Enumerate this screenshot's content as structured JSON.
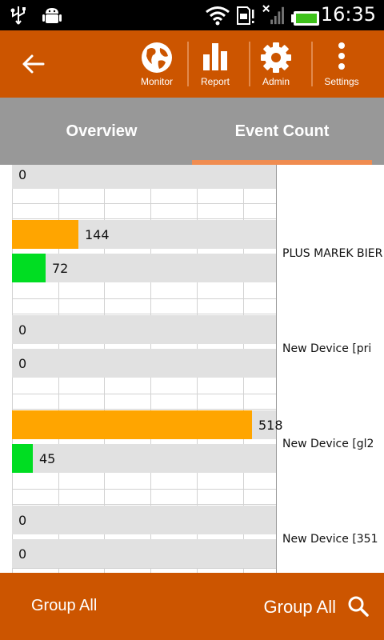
{
  "status_bar": {
    "time": "16:35",
    "icons": [
      "usb-icon",
      "android-debug-icon",
      "wifi-icon",
      "sd-card-warning-icon",
      "no-signal-icon",
      "battery-icon"
    ]
  },
  "action_bar": {
    "actions": [
      {
        "label": "Monitor",
        "icon": "globe-icon"
      },
      {
        "label": "Report",
        "icon": "bar-chart-icon"
      },
      {
        "label": "Admin",
        "icon": "gear-icon"
      },
      {
        "label": "Settings",
        "icon": "more-vert-icon"
      }
    ]
  },
  "tabs": [
    {
      "label": "Overview",
      "selected": false
    },
    {
      "label": "Event Count",
      "selected": true
    }
  ],
  "colors": {
    "primary": "#cc5500",
    "tab_bg": "#989898",
    "tab_indicator": "#f08c50",
    "series_orange": "#ffa500",
    "series_green": "#00dd22",
    "bar_bg": "#e1e1e1"
  },
  "chart_data": {
    "type": "bar",
    "orientation": "horizontal",
    "max_value": 518,
    "bars": [
      {
        "value": 0,
        "label": "0",
        "series": "green"
      },
      {
        "value": 144,
        "label": "144",
        "series": "orange"
      },
      {
        "value": 72,
        "label": "72",
        "series": "green"
      },
      {
        "value": 0,
        "label": "0",
        "series": "orange"
      },
      {
        "value": 0,
        "label": "0",
        "series": "green"
      },
      {
        "value": 518,
        "label": "518",
        "series": "orange"
      },
      {
        "value": 45,
        "label": "45",
        "series": "green"
      },
      {
        "value": 0,
        "label": "0",
        "series": "orange"
      },
      {
        "value": 0,
        "label": "0",
        "series": "green"
      }
    ],
    "device_labels": [
      "PLUS MAREK BIER",
      "New Device [pri",
      "New Device [gl2",
      "New Device [351"
    ]
  },
  "bottom_bar": {
    "left_label": "Group All",
    "right_label": "Group All",
    "search_icon": "search-icon"
  }
}
